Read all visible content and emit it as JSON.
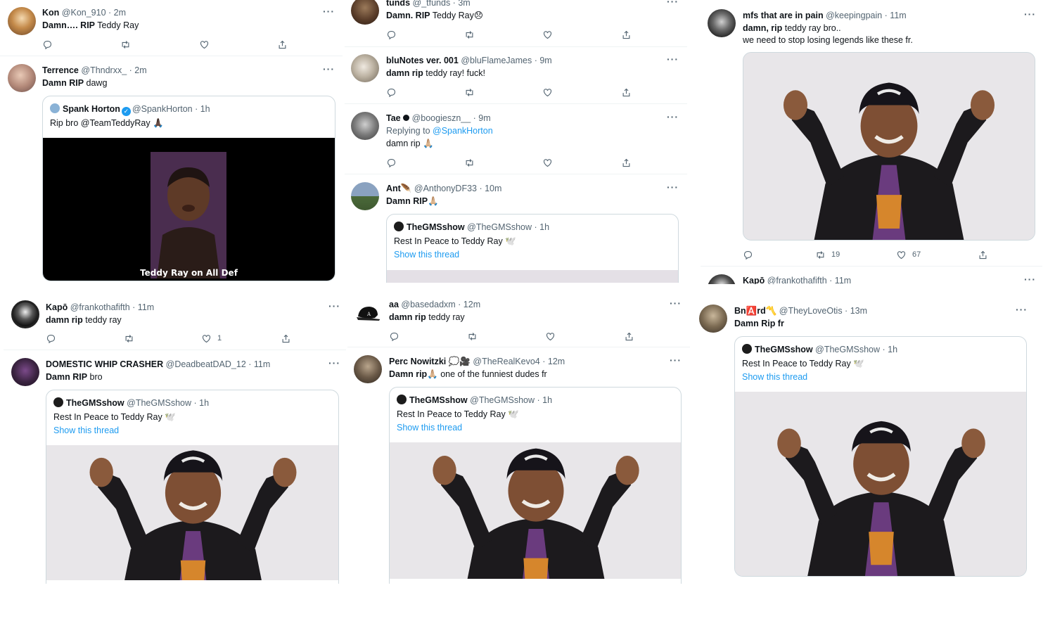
{
  "colors": {
    "accent": "#1d9bf0",
    "muted": "#536471",
    "border": "#cfd9de"
  },
  "more_label": "···",
  "col1": {
    "t1": {
      "name": "Kon",
      "meta": "@Kon_910 · 2m",
      "bold": "Damn…. RIP",
      "rest": " Teddy Ray"
    },
    "t2": {
      "name": "Terrence",
      "meta": "@Thndrxx_ · 2m",
      "bold": "Damn RIP",
      "rest": " dawg",
      "quote": {
        "name": "Spank Horton",
        "meta": "@SpankHorton · 1h",
        "text": "Rip bro @TeamTeddyRay 🙏🏿",
        "video_caption": "Teddy Ray on All Def"
      }
    },
    "t3": {
      "name": "Kapō",
      "meta": "@frankothafifth · 11m",
      "bold": "damn rip",
      "rest": " teddy ray",
      "likes": "1"
    },
    "t4": {
      "name": "DOMESTIC WHIP CRASHER",
      "meta": "@DeadbeatDAD_12 · 11m",
      "bold": "Damn RIP",
      "rest": " bro",
      "quote": {
        "name": "TheGMSshow",
        "meta": "@TheGMSshow · 1h",
        "text": "Rest In Peace to Teddy Ray 🕊️",
        "link": "Show this thread"
      }
    }
  },
  "col2": {
    "t1": {
      "name": "tunds",
      "meta": "@_tfunds · 3m",
      "bold": "Damn. RIP",
      "rest": " Teddy Ray😞"
    },
    "t2": {
      "name": "bluNotes ver. 001",
      "meta": "@bluFlameJames · 9m",
      "bold": "damn rip",
      "rest": " teddy ray! fuck!"
    },
    "t3": {
      "name": "Tae",
      "meta": "@boogieszn__ · 9m",
      "reply_prefix": "Replying to ",
      "reply_handle": "@SpankHorton",
      "text": "damn rip 🙏🏼"
    },
    "t4": {
      "name": "Ant🪶",
      "meta": "@AnthonyDF33 · 10m",
      "bold": "Damn RIP",
      "rest": "🙏🏼",
      "quote": {
        "name": "TheGMSshow",
        "meta": "@TheGMSshow · 1h",
        "text": "Rest In Peace to Teddy Ray 🕊️",
        "link": "Show this thread"
      }
    },
    "t5": {
      "name": "aa",
      "meta": "@basedadxm · 12m",
      "bold": "damn rip",
      "rest": " teddy ray"
    },
    "t6": {
      "name": "Perc Nowitzki 💭🎥",
      "meta": "@TheRealKevo4 · 12m",
      "bold": "Damn rip",
      "rest": "🙏🏼 one of the funniest dudes fr",
      "quote": {
        "name": "TheGMSshow",
        "meta": "@TheGMSshow · 1h",
        "text": "Rest In Peace to Teddy Ray 🕊️",
        "link": "Show this thread"
      }
    }
  },
  "col3": {
    "t1": {
      "name": "mfs that are in pain",
      "meta": "@keepingpain · 11m",
      "bold": "damn, rip",
      "rest": " teddy ray bro..",
      "line2": "we need to stop losing legends like these fr.",
      "retweets": "19",
      "likes": "67"
    },
    "t2": {
      "name": "Kapō",
      "meta": "@frankothafifth · 11m"
    },
    "t3": {
      "name": "Bn🅰️rd〽️",
      "meta": "@TheyLoveOtis · 13m",
      "text": "Damn Rip fr",
      "quote": {
        "name": "TheGMSshow",
        "meta": "@TheGMSshow · 1h",
        "text": "Rest In Peace to Teddy Ray 🕊️",
        "link": "Show this thread"
      }
    }
  }
}
